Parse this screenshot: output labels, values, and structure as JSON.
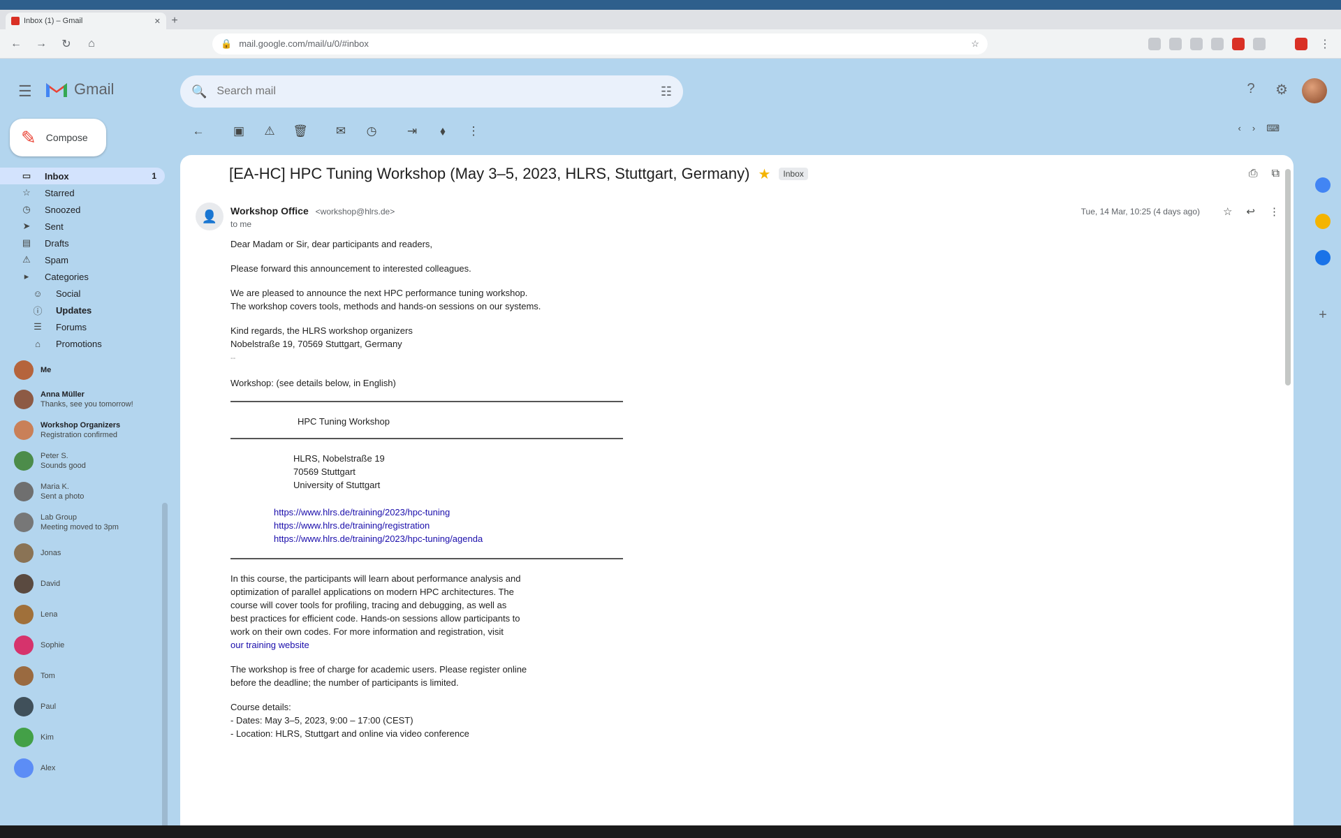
{
  "browser": {
    "tab_title": "Inbox (1) – Gmail",
    "url": "mail.google.com/mail/u/0/#inbox"
  },
  "app": {
    "name": "Gmail",
    "search_placeholder": "Search mail",
    "compose_label": "Compose"
  },
  "sidebar": {
    "folders": [
      {
        "label": "Inbox",
        "count": "1",
        "icon": "inbox-icon",
        "active": true
      },
      {
        "label": "Starred",
        "icon": "star-icon"
      },
      {
        "label": "Snoozed",
        "icon": "clock-icon"
      },
      {
        "label": "Sent",
        "icon": "send-icon"
      },
      {
        "label": "Drafts",
        "icon": "file-icon"
      },
      {
        "label": "Spam",
        "icon": "warning-icon"
      },
      {
        "label": "Categories",
        "icon": "label-icon"
      },
      {
        "label": "Social",
        "icon": "people-icon"
      },
      {
        "label": "Updates",
        "icon": "info-icon"
      },
      {
        "label": "Forums",
        "icon": "chat-icon"
      },
      {
        "label": "Promotions",
        "icon": "tag-icon"
      }
    ],
    "chats": [
      {
        "name": "Me",
        "preview": "",
        "color": "#b5643c"
      },
      {
        "name": "Anna Müller",
        "preview": "Thanks, see you tomorrow!",
        "color": "#8d5a44"
      },
      {
        "name": "Workshop Organizers",
        "preview": "Registration confirmed",
        "color": "#c98058"
      },
      {
        "name": "Peter S.",
        "preview": "Sounds good",
        "color": "#4c8c4a"
      },
      {
        "name": "Maria K.",
        "preview": "Sent a photo",
        "color": "#6f6f6f"
      },
      {
        "name": "Lab Group",
        "preview": "Meeting moved to 3pm",
        "color": "#777"
      },
      {
        "name": "Jonas",
        "preview": "",
        "color": "#8a7355"
      },
      {
        "name": "David",
        "preview": "",
        "color": "#5a4a40"
      },
      {
        "name": "Lena",
        "preview": "",
        "color": "#a0703a"
      },
      {
        "name": "Sophie",
        "preview": "",
        "color": "#d6336c"
      },
      {
        "name": "Tom",
        "preview": "",
        "color": "#9a6a40"
      },
      {
        "name": "Paul",
        "preview": "",
        "color": "#40505a"
      },
      {
        "name": "Kim",
        "preview": "",
        "color": "#43a047"
      },
      {
        "name": "Alex",
        "preview": "",
        "color": "#5c8df6"
      }
    ]
  },
  "thread": {
    "subject": "[EA-HC] HPC Tuning Workshop (May 3–5, 2023, HLRS, Stuttgart, Germany)",
    "label": "Inbox",
    "sender_name": "Workshop Office",
    "sender_email": "<workshop@hlrs.de>",
    "to": "to me",
    "date": "Tue, 14 Mar, 10:25 (4 days ago)",
    "body": {
      "greeting": "Dear Madam or Sir, dear participants and readers,",
      "p1": "Please forward this announcement to interested colleagues.",
      "p2a": "We are pleased to announce the next HPC performance tuning workshop.",
      "p2b": "The workshop covers tools, methods and hands-on sessions on our systems.",
      "p3a": "Kind regards, the HLRS workshop organizers",
      "p3b": "Nobelstraße 19, 70569 Stuttgart, Germany",
      "p3c": "-- ",
      "p4": "Workshop: (see details below, in English)",
      "banner": "HPC Tuning Workshop",
      "addr1": "HLRS, Nobelstraße 19",
      "addr2": "70569 Stuttgart",
      "addr3": "University of Stuttgart",
      "link1": "https://www.hlrs.de/training/2023/hpc-tuning",
      "link2": "https://www.hlrs.de/training/registration",
      "link3": "https://www.hlrs.de/training/2023/hpc-tuning/agenda",
      "d1": "In this course, the participants will learn about performance analysis and",
      "d2": "optimization of parallel applications on modern HPC architectures. The",
      "d3": "course will cover tools for profiling, tracing and debugging, as well as",
      "d4": "best practices for efficient code. Hands-on sessions allow participants to",
      "d5": "work on their own codes. For more information and registration, visit",
      "d6": "our training website",
      "e1": "The workshop is free of charge for academic users. Please register online",
      "e2": "before the deadline; the number of participants is limited.",
      "f1": "Course details:",
      "f2": "- Dates: May 3–5, 2023, 9:00 – 17:00 (CEST)",
      "f3": "- Location: HLRS, Stuttgart and online via video conference"
    }
  },
  "colors": {
    "chrome_blue": "#b3d5ee",
    "gmail_red": "#ea4335",
    "star_yellow": "#f4b400",
    "link": "#1a0dab"
  }
}
